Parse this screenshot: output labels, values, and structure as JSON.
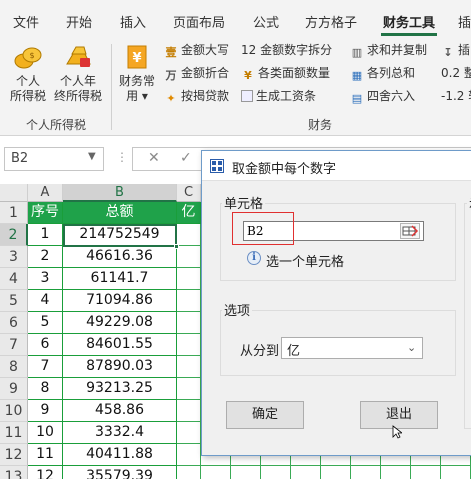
{
  "ribbon": {
    "tabs": [
      "文件",
      "开始",
      "插入",
      "页面布局",
      "公式",
      "方方格子",
      "财务工具",
      "插"
    ],
    "active_tab": "财务工具",
    "accent_color": "#217346",
    "groups": {
      "personal_tax": {
        "label": "个人所得税",
        "buttons": [
          {
            "label": "个人\n所得税",
            "icon": "coins-icon"
          },
          {
            "label": "个人年\n终所得税",
            "icon": "gold-bar-icon"
          }
        ]
      },
      "finance": {
        "label": "财务",
        "big_button": {
          "label": "财务常\n用 ▾",
          "icon": "currency-document-icon"
        },
        "small_buttons": [
          {
            "label": "金额大写",
            "icon": "yen-uppercase-icon"
          },
          {
            "label": "金额折合",
            "icon": "yuan-convert-icon"
          },
          {
            "label": "按揭贷款",
            "icon": "mortgage-icon"
          },
          {
            "label": "12 金额数字拆分",
            "icon": "split-digits-icon"
          },
          {
            "label": "各类面额数量",
            "icon": "yen-denomination-icon"
          },
          {
            "label": "生成工资条",
            "icon": "payslip-icon"
          },
          {
            "label": "求和并复制",
            "icon": "sum-copy-icon"
          },
          {
            "label": "各列总和",
            "icon": "column-sum-icon"
          },
          {
            "label": "四舍六入",
            "icon": "rounding-icon"
          },
          {
            "label": "插",
            "icon": "insert-icon"
          },
          {
            "label": "0.2 整",
            "icon": "round-decimal-icon"
          },
          {
            "label": "-1.2 转",
            "icon": "convert-sign-icon"
          }
        ]
      }
    }
  },
  "formula_bar": {
    "name_box": "B2",
    "cancel_symbol": "✕",
    "enter_symbol": "✓"
  },
  "sheet": {
    "columns": [
      "A",
      "B",
      "C"
    ],
    "selected_column": "B",
    "selected_row": "2",
    "row_numbers": [
      "1",
      "2",
      "3",
      "4",
      "5",
      "6",
      "7",
      "8",
      "9",
      "10",
      "11",
      "12",
      "13"
    ],
    "header_row": [
      "序号",
      "总额",
      "亿"
    ],
    "rows": [
      [
        "1",
        "214752549"
      ],
      [
        "2",
        "46616.36"
      ],
      [
        "3",
        "61141.7"
      ],
      [
        "4",
        "71094.86"
      ],
      [
        "5",
        "49229.08"
      ],
      [
        "6",
        "84601.55"
      ],
      [
        "7",
        "87890.03"
      ],
      [
        "8",
        "93213.25"
      ],
      [
        "9",
        "458.86"
      ],
      [
        "10",
        "3332.4"
      ],
      [
        "11",
        "40411.88"
      ],
      [
        "12",
        "35579.39"
      ]
    ],
    "header_color": "#1fa24a",
    "grid_color": "#1a9e3a"
  },
  "dialog": {
    "title": "取金额中每个数字",
    "cell_group_label": "单元格",
    "cell_value": "B2",
    "hint": "选一个单元格",
    "options_group_label": "选项",
    "split_to_label": "从分到",
    "split_to_value": "亿",
    "ok_label": "确定",
    "exit_label": "退出",
    "right_fieldset_label_partial": "示",
    "highlight_color": "#e03030"
  }
}
